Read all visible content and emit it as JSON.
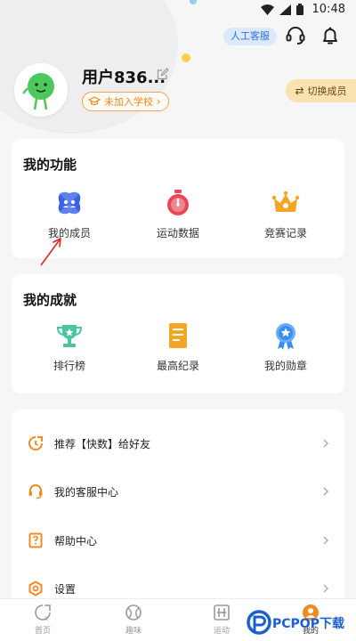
{
  "status_bar": {
    "time": "10:48"
  },
  "header": {
    "service_label": "人工客服",
    "username": "用户836...",
    "school_label": "未加入学校",
    "switch_label": "切换成员"
  },
  "functions": {
    "title": "我的功能",
    "items": [
      {
        "label": "我的成员",
        "icon": "members-icon"
      },
      {
        "label": "运动数据",
        "icon": "stopwatch-icon"
      },
      {
        "label": "竞赛记录",
        "icon": "crown-icon"
      }
    ]
  },
  "achievements": {
    "title": "我的成就",
    "items": [
      {
        "label": "排行榜",
        "icon": "trophy-icon"
      },
      {
        "label": "最高纪录",
        "icon": "record-icon"
      },
      {
        "label": "我的勋章",
        "icon": "medal-icon"
      }
    ]
  },
  "menu": [
    {
      "label": "推荐【快数】给好友",
      "icon": "share-icon"
    },
    {
      "label": "我的客服中心",
      "icon": "headset-icon"
    },
    {
      "label": "帮助中心",
      "icon": "help-icon"
    },
    {
      "label": "设置",
      "icon": "settings-icon"
    }
  ],
  "tabbar": [
    {
      "label": "首页",
      "icon": "home-icon"
    },
    {
      "label": "趣味",
      "icon": "ball-icon"
    },
    {
      "label": "运动",
      "icon": "sport-icon"
    },
    {
      "label": "我的",
      "icon": "profile-icon"
    }
  ],
  "watermark": {
    "text": "PCPOP下载"
  },
  "colors": {
    "accent": "#f08a24",
    "service_blue": "#2c6fe0",
    "switch_bg": "#fbe3b1"
  }
}
